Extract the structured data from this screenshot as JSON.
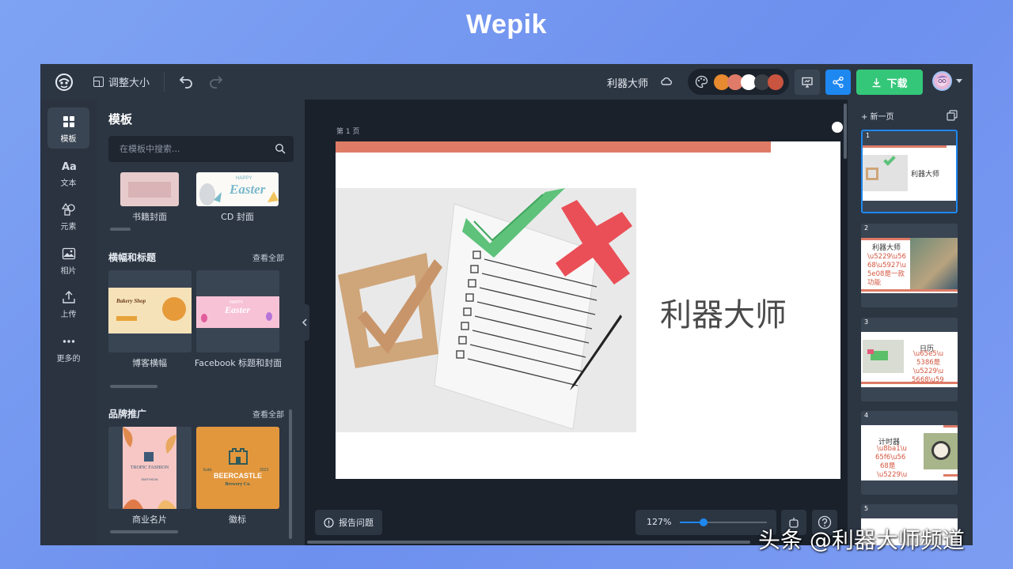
{
  "brand": "Wepik",
  "topbar": {
    "resize_label": "调整大小",
    "doc_title": "利器大师",
    "palette_colors": [
      "#e88a2f",
      "#e07b6a",
      "#ffffff",
      "#3b3f46",
      "#c9543f"
    ],
    "download_label": "下载"
  },
  "rail": {
    "items": [
      {
        "label": "模板",
        "icon": "template-icon"
      },
      {
        "label": "文本",
        "icon": "text-icon"
      },
      {
        "label": "元素",
        "icon": "shapes-icon"
      },
      {
        "label": "相片",
        "icon": "image-icon"
      },
      {
        "label": "上传",
        "icon": "upload-icon"
      },
      {
        "label": "更多的",
        "icon": "more-icon"
      }
    ]
  },
  "panel": {
    "title": "模板",
    "search_placeholder": "在模板中搜索...",
    "row1": {
      "cards": [
        {
          "label": "书籍封面"
        },
        {
          "label": "CD 封面",
          "text": "Easter",
          "text_small": "HAPPY"
        }
      ]
    },
    "banners": {
      "title": "横幅和标题",
      "view_all": "查看全部",
      "cards": [
        {
          "label": "博客横幅",
          "text": "Bakery Shop"
        },
        {
          "label": "Facebook 标题和封面",
          "text": "Easter",
          "text_small": "HAPPY"
        }
      ]
    },
    "branding": {
      "title": "品牌推广",
      "view_all": "查看全部",
      "cards": [
        {
          "label": "商业名片",
          "text": "TROPIC FASHION",
          "text_small": "SMITHSON"
        },
        {
          "label": "徽标",
          "text": "BEERCASTLE",
          "text_small": "Brewery Co.",
          "left_text": "Estd.",
          "right_text": "2023"
        }
      ]
    }
  },
  "canvas": {
    "page_label": "第 1 页",
    "slide_title": "利器大师",
    "report_label": "报告问题",
    "zoom_label": "127%",
    "zoom_fraction": 0.27
  },
  "pages": {
    "new_page_label": "+ 新一页",
    "thumbs": [
      {
        "num": "1",
        "title": "利器大师"
      },
      {
        "num": "2",
        "title": "利器大师",
        "lines": [
          "\\u5229\\u56",
          "68\\u5927\\u",
          "5e08是一款",
          "功能"
        ]
      },
      {
        "num": "3",
        "title": "日历",
        "lines": [
          "\\u65e5\\u",
          "5386是",
          "\\u5229\\u",
          "5668\\u59"
        ]
      },
      {
        "num": "4",
        "title": "计时器",
        "lines": [
          "\\u8ba1\\u",
          "65f6\\u56",
          "68是",
          "\\u5229\\u"
        ]
      },
      {
        "num": "5"
      }
    ]
  },
  "watermark": "头条 @利器大师频道"
}
